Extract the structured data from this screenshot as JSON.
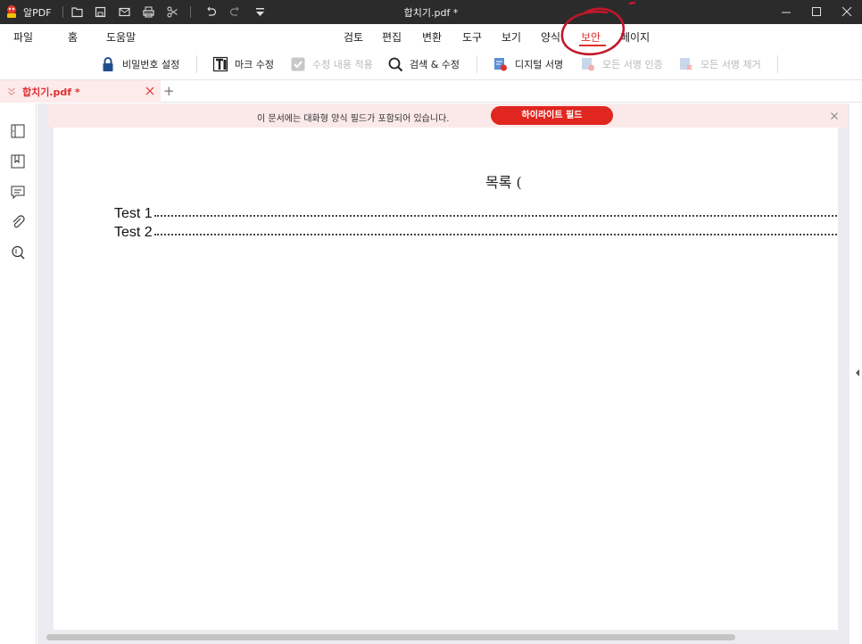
{
  "titlebar": {
    "app_name": "알PDF",
    "document_title": "합치기.pdf *"
  },
  "menu": {
    "left_items": [
      "파일",
      "홈",
      "도움말"
    ],
    "tabs": [
      "검토",
      "편집",
      "변환",
      "도구",
      "보기",
      "양식",
      "보안",
      "페이지"
    ],
    "active_tab": "보안"
  },
  "toolbar": {
    "password": "비밀번호 설정",
    "mark_redact": "마크 수정",
    "apply_redact": "수정 내용 적용",
    "search_redact": "검색 & 수정",
    "digital_sign": "디지털 서명",
    "verify_all": "모든 서명 인증",
    "remove_all": "모든 서명 제거"
  },
  "tabs": {
    "doc_tab": "합치기.pdf *",
    "new_tab": "+"
  },
  "notice": {
    "message": "이 문서에는 대화형 양식 필드가 포함되어 있습니다.",
    "button": "하이라이트 필드"
  },
  "document": {
    "toc_title": "목록 (",
    "entries": [
      "Test 1",
      "Test 2"
    ]
  },
  "colors": {
    "accent": "#e02e2e",
    "titlebar": "#2b2b2b",
    "notice_bg": "#fbe9e9"
  }
}
